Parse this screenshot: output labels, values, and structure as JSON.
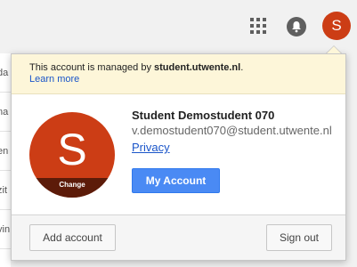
{
  "topbar": {
    "apps_icon": "grid-apps-icon",
    "notifications_icon": "bell-icon",
    "avatar_letter": "S"
  },
  "left_strip": [
    "da",
    "na",
    "en",
    "zit",
    "vin"
  ],
  "banner": {
    "prefix": "This account is managed by ",
    "domain": "student.utwente.nl",
    "suffix": ".",
    "learn_more": "Learn more"
  },
  "profile": {
    "avatar_letter": "S",
    "change_label": "Change",
    "name": "Student Demostudent 070",
    "email": "v.demostudent070@student.utwente.nl",
    "privacy": "Privacy",
    "my_account_label": "My Account"
  },
  "footer": {
    "add_account": "Add account",
    "sign_out": "Sign out"
  },
  "colors": {
    "avatar": "#cc3d15",
    "primary_button": "#4a8af4",
    "banner_bg": "#fdf6d9",
    "link": "#1a55c9"
  }
}
